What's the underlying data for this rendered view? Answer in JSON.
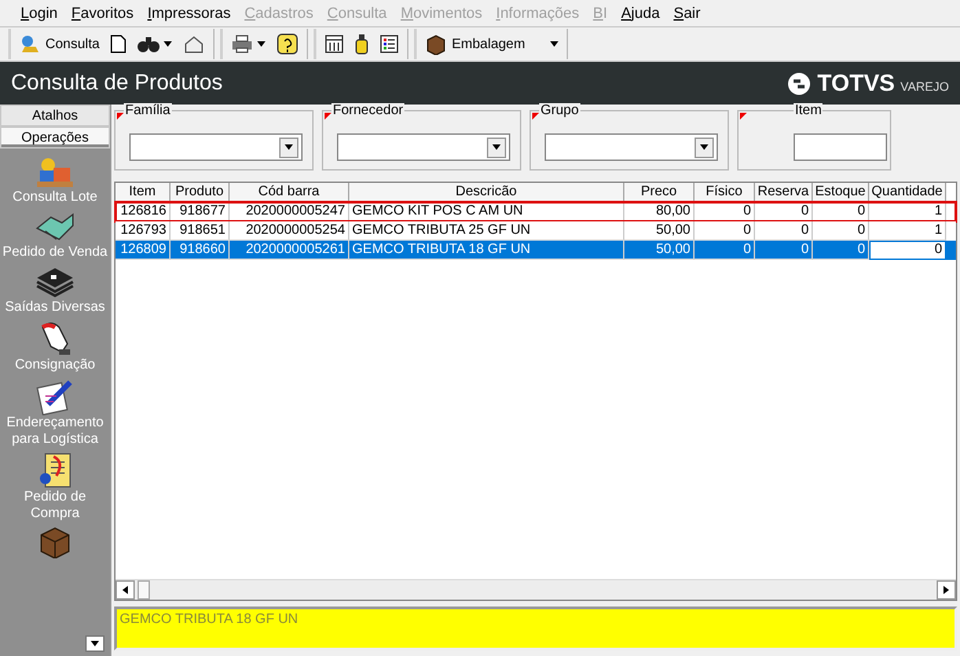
{
  "menu": [
    {
      "label": "Login",
      "disabled": false
    },
    {
      "label": "Favoritos",
      "disabled": false
    },
    {
      "label": "Impressoras",
      "disabled": false
    },
    {
      "label": "Cadastros",
      "disabled": true
    },
    {
      "label": "Consulta",
      "disabled": true
    },
    {
      "label": "Movimentos",
      "disabled": true
    },
    {
      "label": "Informações",
      "disabled": true
    },
    {
      "label": "BI",
      "disabled": true
    },
    {
      "label": "Ajuda",
      "disabled": false
    },
    {
      "label": "Sair",
      "disabled": false
    }
  ],
  "toolbar": {
    "consulta": "Consulta",
    "embalagem": "Embalagem"
  },
  "header": {
    "title": "Consulta de Produtos",
    "brand": "TOTVS",
    "brand_sub": "VAREJO"
  },
  "sidebar": {
    "tabs": [
      {
        "label": "Atalhos",
        "selected": false
      },
      {
        "label": "Operações",
        "selected": true
      }
    ],
    "items": [
      {
        "label": "Consulta Lote",
        "kind": "lote"
      },
      {
        "label": "Pedido de Venda",
        "kind": "venda"
      },
      {
        "label": "Saídas Diversas",
        "kind": "saidas"
      },
      {
        "label": "Consignação",
        "kind": "consignacao"
      },
      {
        "label": "Endereçamento para Logística",
        "kind": "logistica"
      },
      {
        "label": "Pedido de Compra",
        "kind": "compra"
      },
      {
        "kind": "box"
      }
    ]
  },
  "filters": [
    {
      "label": "Família",
      "kind": "combo"
    },
    {
      "label": "Fornecedor",
      "kind": "combo"
    },
    {
      "label": "Grupo",
      "kind": "combo"
    },
    {
      "label": "Item",
      "kind": "text"
    }
  ],
  "table": {
    "columns": [
      "Item",
      "Produto",
      "Cód barra",
      "Descricão",
      "Preco",
      "Físico",
      "Reserva",
      "Estoque",
      "Quantidade"
    ],
    "rows": [
      {
        "cells": [
          "126816",
          "918677",
          "2020000005247",
          "GEMCO KIT POS C  AM UN",
          "80,00",
          "0",
          "0",
          "0",
          "1"
        ],
        "selected": false,
        "highlighted": true
      },
      {
        "cells": [
          "126793",
          "918651",
          "2020000005254",
          "GEMCO TRIBUTA 25  GF UN",
          "50,00",
          "0",
          "0",
          "0",
          "1"
        ],
        "selected": false,
        "highlighted": false
      },
      {
        "cells": [
          "126809",
          "918660",
          "2020000005261",
          "GEMCO TRIBUTA 18  GF UN",
          "50,00",
          "0",
          "0",
          "0",
          "0"
        ],
        "selected": true,
        "highlighted": false
      }
    ]
  },
  "description_bar": "GEMCO TRIBUTA 18  GF UN"
}
